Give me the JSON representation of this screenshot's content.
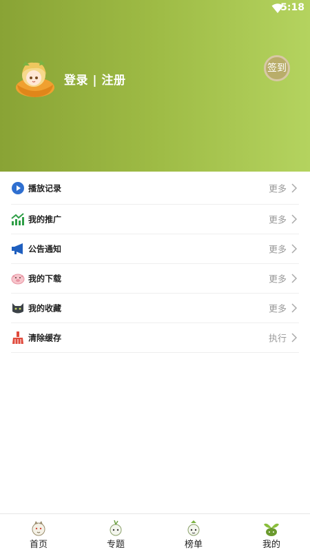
{
  "status_bar": {
    "time": "5:18"
  },
  "profile": {
    "login_text": "登录 | 注册",
    "checkin_label": "签到"
  },
  "menu": [
    {
      "label": "播放记录",
      "action": "更多",
      "icon": "play-icon"
    },
    {
      "label": "我的推广",
      "action": "更多",
      "icon": "chart-icon"
    },
    {
      "label": "公告通知",
      "action": "更多",
      "icon": "megaphone-icon"
    },
    {
      "label": "我的下载",
      "action": "更多",
      "icon": "pig-icon"
    },
    {
      "label": "我的收藏",
      "action": "更多",
      "icon": "cat-icon"
    },
    {
      "label": "清除缓存",
      "action": "执行",
      "icon": "broom-icon"
    }
  ],
  "tabs": [
    {
      "label": "首页",
      "icon": "home-mascot-icon"
    },
    {
      "label": "专题",
      "icon": "topic-mascot-icon"
    },
    {
      "label": "榜单",
      "icon": "ranking-mascot-icon"
    },
    {
      "label": "我的",
      "icon": "sprout-icon",
      "active": true
    }
  ],
  "colors": {
    "header_start": "#89a335",
    "header_end": "#b4d35f",
    "accent": "#8aae3a"
  }
}
